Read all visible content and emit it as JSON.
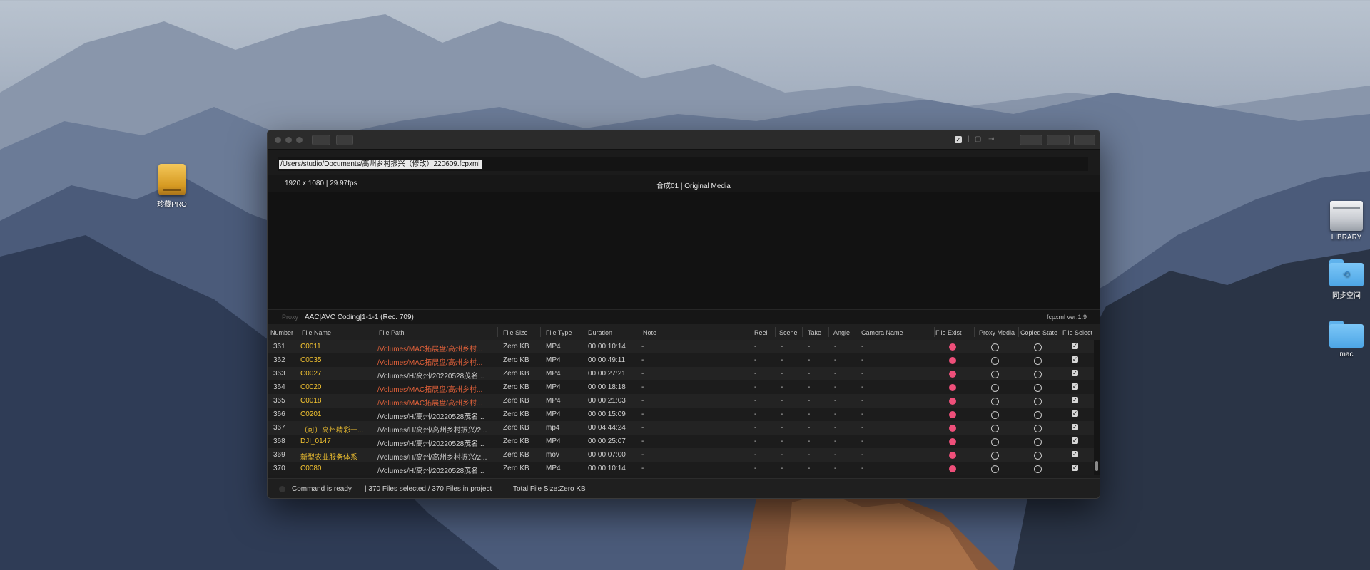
{
  "desktop": {
    "icons": [
      {
        "label": "珍藏PRO"
      },
      {
        "label": "LIBRARY"
      },
      {
        "label": "同步空间"
      },
      {
        "label": "mac"
      }
    ]
  },
  "window": {
    "file_path": "/Users/studio/Documents/高州乡村振兴（修改）220609.fcpxml",
    "resolution": "1920 x 1080 | 29.97fps",
    "sequence": "合成01 | Original Media",
    "proxy_label": "Proxy",
    "codec": "AAC|AVC Coding|1-1-1 (Rec. 709)",
    "version": "fcpxml ver:1.9",
    "columns": {
      "number": "Number",
      "file_name": "File Name",
      "file_path": "File Path",
      "file_size": "File Size",
      "file_type": "File Type",
      "duration": "Duration",
      "note": "Note",
      "reel": "Reel",
      "scene": "Scene",
      "take": "Take",
      "angle": "Angle",
      "camera_name": "Camera Name",
      "file_exist": "File Exist",
      "proxy_media": "Proxy Media",
      "copied_state": "Copied State",
      "file_select": "File Select"
    },
    "rows": [
      {
        "num": "361",
        "name": "C0011",
        "path": "/Volumes/MAC拓展盘/高州乡村...",
        "path_warn": true,
        "size": "Zero KB",
        "type": "MP4",
        "duration": "00:00:10:14",
        "note": "-",
        "reel": "-",
        "scene": "-",
        "take": "-",
        "angle": "-",
        "cam": "-"
      },
      {
        "num": "362",
        "name": "C0035",
        "path": "/Volumes/MAC拓展盘/高州乡村...",
        "path_warn": true,
        "size": "Zero KB",
        "type": "MP4",
        "duration": "00:00:49:11",
        "note": "-",
        "reel": "-",
        "scene": "-",
        "take": "-",
        "angle": "-",
        "cam": "-"
      },
      {
        "num": "363",
        "name": "C0027",
        "path": "/Volumes/H/高州/20220528茂名...",
        "path_warn": false,
        "size": "Zero KB",
        "type": "MP4",
        "duration": "00:00:27:21",
        "note": "-",
        "reel": "-",
        "scene": "-",
        "take": "-",
        "angle": "-",
        "cam": "-"
      },
      {
        "num": "364",
        "name": "C0020",
        "path": "/Volumes/MAC拓展盘/高州乡村...",
        "path_warn": true,
        "size": "Zero KB",
        "type": "MP4",
        "duration": "00:00:18:18",
        "note": "-",
        "reel": "-",
        "scene": "-",
        "take": "-",
        "angle": "-",
        "cam": "-"
      },
      {
        "num": "365",
        "name": "C0018",
        "path": "/Volumes/MAC拓展盘/高州乡村...",
        "path_warn": true,
        "size": "Zero KB",
        "type": "MP4",
        "duration": "00:00:21:03",
        "note": "-",
        "reel": "-",
        "scene": "-",
        "take": "-",
        "angle": "-",
        "cam": "-"
      },
      {
        "num": "366",
        "name": "C0201",
        "path": "/Volumes/H/高州/20220528茂名...",
        "path_warn": false,
        "size": "Zero KB",
        "type": "MP4",
        "duration": "00:00:15:09",
        "note": "-",
        "reel": "-",
        "scene": "-",
        "take": "-",
        "angle": "-",
        "cam": "-"
      },
      {
        "num": "367",
        "name": "（可）高州精彩一...",
        "path": "/Volumes/H/高州/高州乡村振兴/2...",
        "path_warn": false,
        "size": "Zero KB",
        "type": "mp4",
        "duration": "00:04:44:24",
        "note": "-",
        "reel": "-",
        "scene": "-",
        "take": "-",
        "angle": "-",
        "cam": "-"
      },
      {
        "num": "368",
        "name": "DJI_0147",
        "path": "/Volumes/H/高州/20220528茂名...",
        "path_warn": false,
        "size": "Zero KB",
        "type": "MP4",
        "duration": "00:00:25:07",
        "note": "-",
        "reel": "-",
        "scene": "-",
        "take": "-",
        "angle": "-",
        "cam": "-"
      },
      {
        "num": "369",
        "name": "新型农业服务体系",
        "path": "/Volumes/H/高州/高州乡村振兴/2...",
        "path_warn": false,
        "size": "Zero KB",
        "type": "mov",
        "duration": "00:00:07:00",
        "note": "-",
        "reel": "-",
        "scene": "-",
        "take": "-",
        "angle": "-",
        "cam": "-"
      },
      {
        "num": "370",
        "name": "C0080",
        "path": "/Volumes/H/高州/20220528茂名...",
        "path_warn": false,
        "size": "Zero KB",
        "type": "MP4",
        "duration": "00:00:10:14",
        "note": "-",
        "reel": "-",
        "scene": "-",
        "take": "-",
        "angle": "-",
        "cam": "-"
      }
    ],
    "status": {
      "command": "Command is ready",
      "selection": "| 370 Files selected / 370 Files in project",
      "total_size": "Total File Size:Zero KB"
    }
  },
  "colors": {
    "file_name": "#f2c230",
    "warn_path": "#e2613a",
    "file_exist_dot": "#ef4f7a"
  }
}
